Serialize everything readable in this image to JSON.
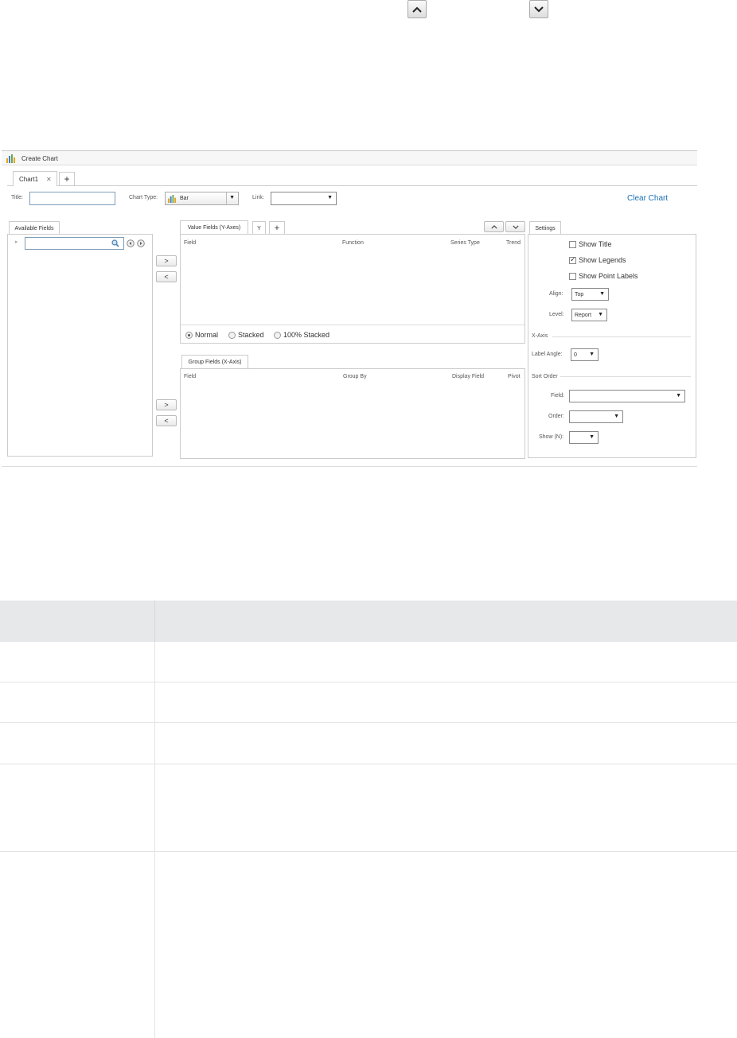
{
  "nav": {
    "up_icon": "chevron-up-icon",
    "down_icon": "chevron-down-icon"
  },
  "window": {
    "title": "Create Chart",
    "tabs": [
      {
        "label": "Chart1",
        "close": "✕"
      }
    ],
    "add_tab": "+",
    "title_label": "Title:",
    "title_value": "",
    "chart_type_label": "Chart Type:",
    "chart_type_value": "Bar",
    "link_label": "Link:",
    "link_value": "",
    "clear_chart": "Clear Chart",
    "available_fields": {
      "tab": "Available Fields",
      "search_value": ""
    },
    "move_right": ">",
    "move_left": "<",
    "value_fields": {
      "tab": "Value Fields (Y-Axes)",
      "sub_tab": "Y",
      "add": "+",
      "columns": [
        "Field",
        "Function",
        "Series Type",
        "Trend"
      ],
      "up": "^",
      "down": "v"
    },
    "stacking": {
      "options": [
        "Normal",
        "Stacked",
        "100% Stacked"
      ],
      "selected": "Normal"
    },
    "group_fields": {
      "tab": "Group Fields (X-Axis)",
      "columns": [
        "Field",
        "Group By",
        "Display Field",
        "Pivot"
      ]
    },
    "settings": {
      "tab": "Settings",
      "show_title": {
        "label": "Show Title",
        "checked": false
      },
      "show_legends": {
        "label": "Show Legends",
        "checked": true
      },
      "show_point_labels": {
        "label": "Show Point Labels",
        "checked": false
      },
      "align_label": "Align:",
      "align_value": "Top",
      "level_label": "Level:",
      "level_value": "Report",
      "xaxis_title": "X-Axis",
      "label_angle_label": "Label Angle:",
      "label_angle_value": "0",
      "sort_order_title": "Sort Order",
      "field_label": "Field:",
      "field_value": "",
      "order_label": "Order:",
      "order_value": "",
      "show_n_label": "Show (N):",
      "show_n_value": ""
    }
  },
  "table": {
    "header": [
      "",
      ""
    ],
    "rows": [
      [
        "",
        ""
      ],
      [
        "",
        ""
      ],
      [
        "",
        ""
      ],
      [
        "",
        ""
      ],
      [
        "",
        ""
      ]
    ]
  },
  "colors": {
    "link": "#1a6fb5",
    "header_bg": "#e6e8ea"
  }
}
